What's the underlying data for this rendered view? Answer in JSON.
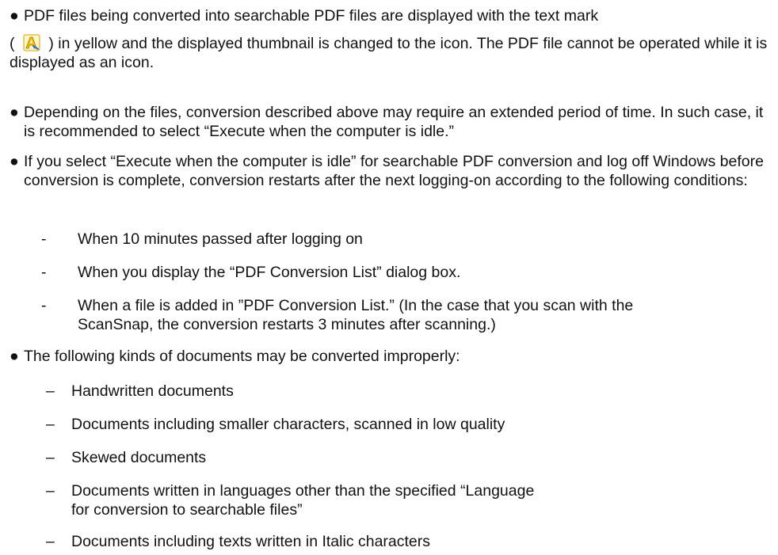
{
  "bullet_symbol": "●",
  "notes": [
    {
      "line1": "PDF files being converted into searchable PDF files are displayed with the text mark",
      "line2_open": "(",
      "line2_rest": ") in yellow and the displayed thumbnail is changed to the icon. The PDF file cannot be operated while it is displayed as an icon.",
      "icon": "pdf-conversion-mark-icon"
    },
    {
      "text": "Depending on the files, conversion described above may require an extended period of time. In such case, it is recommended to select “Execute when the computer is idle.”"
    },
    {
      "text": "If you select “Execute when the computer is idle” for searchable PDF conversion and log off Windows before conversion is complete, conversion restarts after the next logging-on according to the following conditions:",
      "dash": "-",
      "conditions": [
        "When 10 minutes passed after logging on",
        "When you display the “PDF Conversion List” dialog box.",
        "When a file is added in ”PDF Conversion List.” (In the case that you scan with the ScanSnap, the conversion restarts 3 minutes after scanning.)"
      ]
    },
    {
      "text": "The following kinds of documents may be converted improperly:",
      "dash": "–",
      "items": [
        "Handwritten documents",
        "Documents including smaller characters, scanned in low quality",
        "Skewed documents",
        "Documents written in languages other than the specified “Language for conversion to searchable files”",
        "Documents including texts written in Italic characters"
      ]
    }
  ],
  "colors": {
    "text": "#111111",
    "icon_yellow": "#f2c200"
  }
}
